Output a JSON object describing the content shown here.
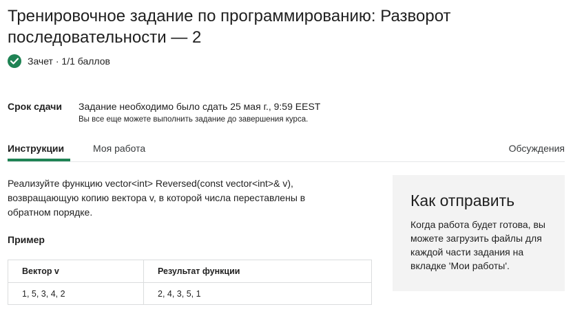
{
  "title": "Тренировочное задание по программированию: Разворот последовательности — 2",
  "grade": {
    "text": "Зачет · 1/1 баллов",
    "status_color": "#1f8354",
    "icon": "check-circle-icon"
  },
  "deadline": {
    "label": "Срок сдачи",
    "main": "Задание необходимо было сдать 25 мая г., 9:59 EEST",
    "sub": "Вы все еще можете выполнить задание до завершения курса."
  },
  "tabs": {
    "instructions": "Инструкции",
    "my_work": "Моя работа",
    "discussions": "Обсуждения",
    "accent_color": "#1f8354"
  },
  "instructions": {
    "description": "Реализуйте функцию vector<int> Reversed(const vector<int>& v), возвращающую копию вектора v, в которой числа переставлены в обратном порядке.",
    "example_heading": "Пример",
    "table": {
      "headers": [
        "Вектор v",
        "Результат функции"
      ],
      "rows": [
        [
          "1, 5, 3, 4, 2",
          "2, 4, 3, 5, 1"
        ]
      ]
    }
  },
  "how_to_submit": {
    "title": "Как отправить",
    "text": "Когда работа будет готова, вы можете загрузить файлы для каждой части задания на вкладке 'Мои работы'."
  }
}
